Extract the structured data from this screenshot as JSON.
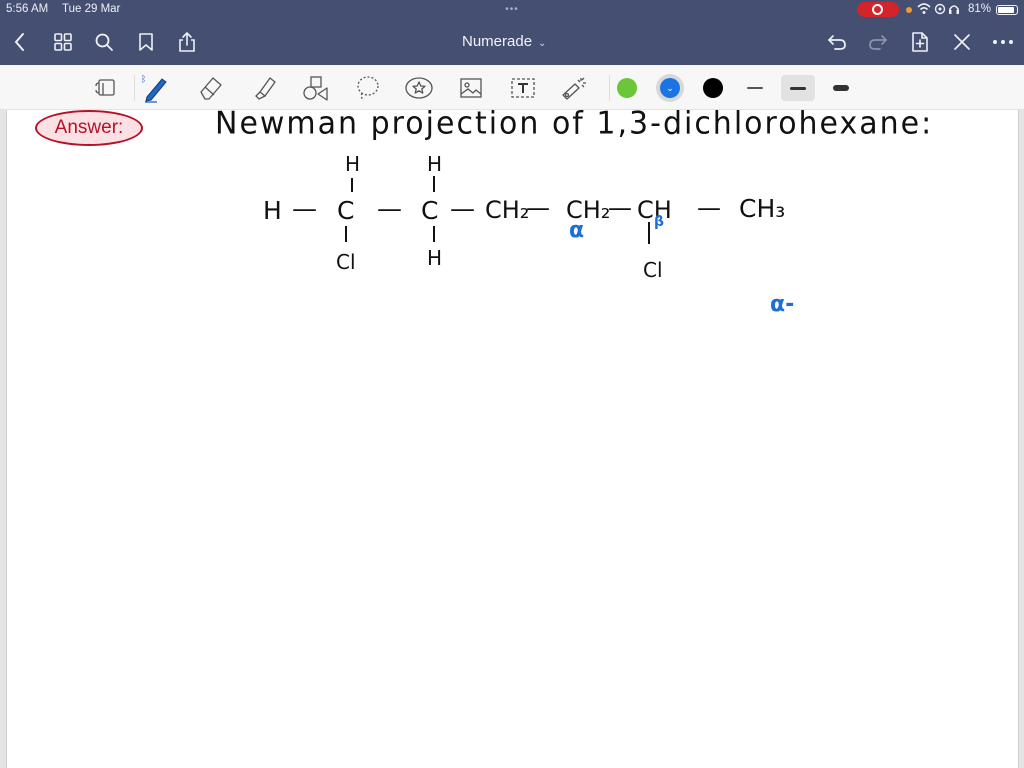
{
  "status_bar": {
    "time": "5:56 AM",
    "date": "Tue 29 Mar",
    "multitask_dots": "•••",
    "battery_percent": "81%",
    "recording_indicator": "screen-recording-icon",
    "icons": [
      "orange-dot-indicator",
      "wifi-icon",
      "orientation-lock-icon",
      "headphones-icon",
      "battery-icon"
    ]
  },
  "nav": {
    "title": "Numerade",
    "left_icons": [
      "back-icon",
      "grid-icon",
      "search-icon",
      "bookmark-icon",
      "share-icon"
    ],
    "right_icons": [
      "undo-icon",
      "redo-icon",
      "add-page-icon",
      "close-pen-icon",
      "more-icon"
    ]
  },
  "toolbar": {
    "tools": [
      "read-mode",
      "pen",
      "eraser",
      "highlighter",
      "shapes",
      "lasso",
      "sticker",
      "image",
      "text",
      "laser-pointer"
    ],
    "active_tool": "pen",
    "colors": [
      {
        "name": "green",
        "hex": "#6cc63a"
      },
      {
        "name": "blue",
        "hex": "#1b74e4",
        "selected": true
      },
      {
        "name": "black",
        "hex": "#000000"
      }
    ],
    "stroke_widths": [
      "thin",
      "medium",
      "thick"
    ],
    "active_stroke": "medium"
  },
  "note": {
    "answer_label": "Answer:",
    "heading": "Newman projection of 1,3-dichlorohexane:",
    "structure": {
      "main_chain": [
        "H",
        "—",
        "C",
        "—",
        "C",
        "—",
        "CH₂",
        "—",
        "CH₂",
        "—",
        "CH",
        "—",
        "CH₃"
      ],
      "c1_top": "H",
      "c1_bottom": "Cl",
      "c2_top": "H",
      "c2_bottom": "H",
      "ch_bottom": "Cl",
      "ch2_sub": "2"
    },
    "annotations": {
      "alpha_label": "α",
      "beta_label": "β",
      "alpha_dash": "α-"
    },
    "ink_colors": {
      "black": "#111111",
      "blue": "#1b6fd6",
      "answer_red": "#b5122a"
    }
  }
}
